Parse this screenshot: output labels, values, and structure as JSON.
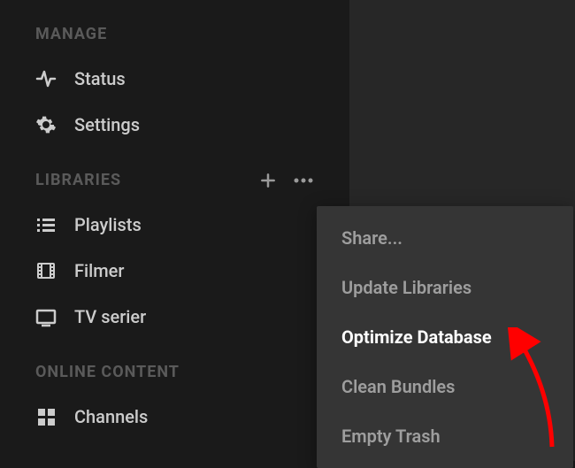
{
  "sidebar": {
    "sections": {
      "manage": {
        "title": "MANAGE",
        "items": [
          {
            "label": "Status"
          },
          {
            "label": "Settings"
          }
        ]
      },
      "libraries": {
        "title": "LIBRARIES",
        "items": [
          {
            "label": "Playlists"
          },
          {
            "label": "Filmer"
          },
          {
            "label": "TV serier"
          }
        ]
      },
      "online": {
        "title": "ONLINE CONTENT",
        "items": [
          {
            "label": "Channels"
          }
        ]
      }
    }
  },
  "menu": {
    "items": [
      {
        "label": "Share..."
      },
      {
        "label": "Update Libraries"
      },
      {
        "label": "Optimize Database"
      },
      {
        "label": "Clean Bundles"
      },
      {
        "label": "Empty Trash"
      }
    ]
  }
}
